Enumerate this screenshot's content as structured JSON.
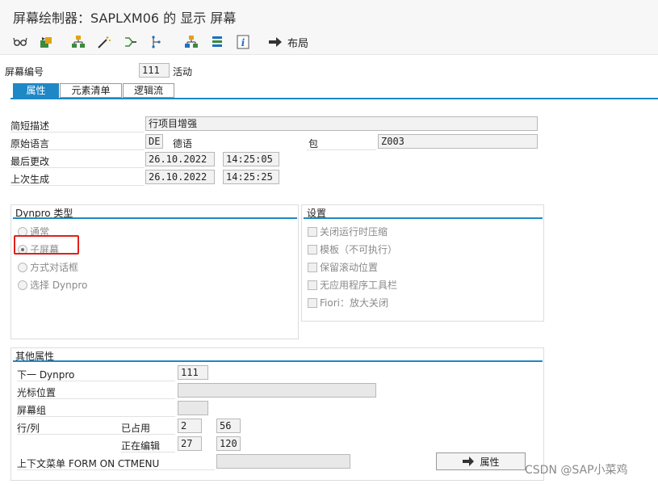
{
  "window": {
    "title": "屏幕绘制器：SAPLXM06 的 显示 屏幕"
  },
  "toolbar": {
    "icons": [
      "glasses-icon",
      "transport-icon",
      "hierarchy-icon",
      "magic-wand-icon",
      "split-icon",
      "tree-icon",
      "stack-icon",
      "info-icon"
    ],
    "layout_label": "布局",
    "colors": {
      "accent": "#1e88c7",
      "highlight": "#e0201b"
    }
  },
  "header": {
    "screen_number_label": "屏幕编号",
    "screen_number": "111",
    "status": "活动"
  },
  "tabs": [
    {
      "label": "属性"
    },
    {
      "label": "元素清单"
    },
    {
      "label": "逻辑流"
    }
  ],
  "attributes": {
    "short_desc_label": "简短描述",
    "short_desc": "行项目增强",
    "orig_lang_label": "原始语言",
    "orig_lang_code": "DE",
    "orig_lang_name": "德语",
    "package_label": "包",
    "package": "Z003",
    "last_changed_label": "最后更改",
    "last_changed_date": "26.10.2022",
    "last_changed_time": "14:25:05",
    "last_gen_label": "上次生成",
    "last_gen_date": "26.10.2022",
    "last_gen_time": "14:25:25"
  },
  "dynpro_type": {
    "title": "Dynpro 类型",
    "options": [
      "通常",
      "子屏幕",
      "方式对话框",
      "选择 Dynpro"
    ]
  },
  "settings": {
    "title": "设置",
    "options": [
      "关闭运行时压缩",
      "模板（不可执行）",
      "保留滚动位置",
      "无应用程序工具栏",
      "Fiori：放大关闭"
    ]
  },
  "other": {
    "title": "其他属性",
    "next_dynpro_label": "下一 Dynpro",
    "next_dynpro": "111",
    "cursor_pos_label": "光标位置",
    "cursor_pos": "",
    "screen_group_label": "屏幕组",
    "screen_group": "",
    "rowcol_label": "行/列",
    "used_label": "已占用",
    "used_row": "2",
    "used_col": "56",
    "editing_label": "正在编辑",
    "edit_row": "27",
    "edit_col": "120",
    "context_menu_label": "上下文菜单 FORM ON CTMENU",
    "context_menu": "",
    "attr_button": "属性"
  },
  "watermark": "CSDN @SAP小菜鸡"
}
